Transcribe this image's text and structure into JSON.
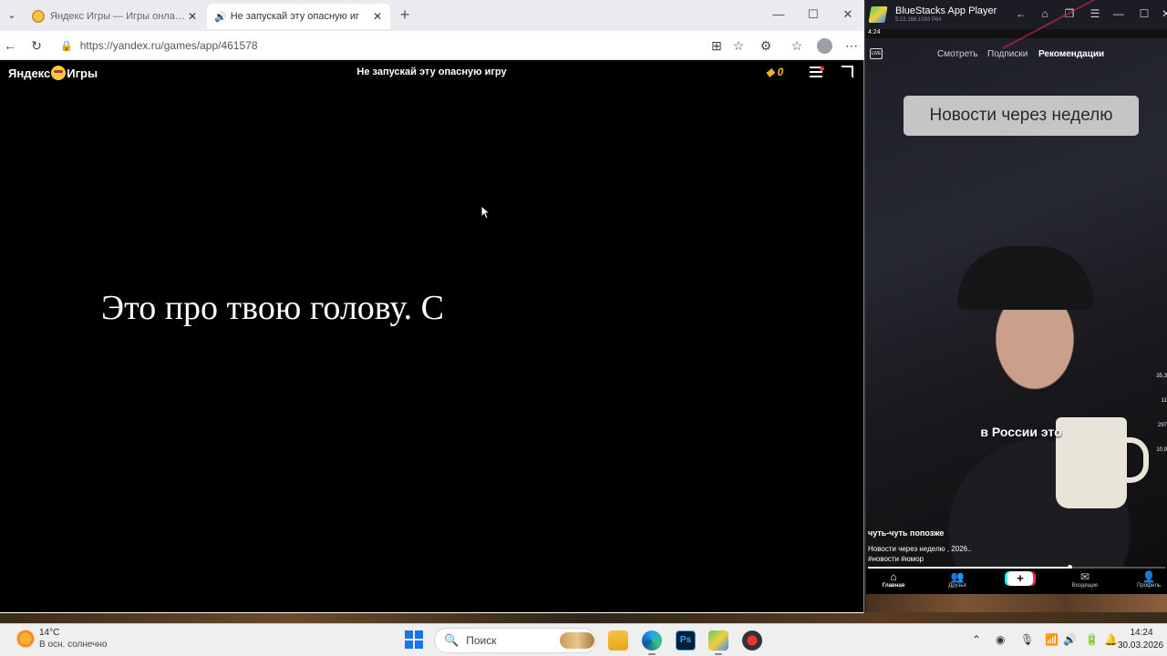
{
  "browser": {
    "tabs": [
      {
        "title": "Яндекс Игры — Игры онлайн бе",
        "active": false
      },
      {
        "title": "Не запускай эту опасную иг",
        "active": true
      }
    ],
    "url": "https://yandex.ru/games/app/461578"
  },
  "game": {
    "logo": "Яндекс",
    "logo_suffix": "Игры",
    "title": "Не запускай эту опасную игру",
    "coins": "0",
    "dialogue_text": "Это про твою голову. С"
  },
  "bluestacks": {
    "app_name": "BlueStacks App Player",
    "version": "5.22.166.1003 P64",
    "status_time": "4:24",
    "feed_tabs": [
      "Смотреть",
      "Подписки",
      "Рекомендации"
    ],
    "headline": "Новости через неделю",
    "subtitle": "в России это",
    "post_title": "чуть-чуть попозже",
    "post_desc_line1": "Новости через неделю , 2026..",
    "post_desc_line2": "#новости #юмор",
    "video_progress": 0.68,
    "side_counts": [
      "35,3",
      "11",
      "297",
      "10,9"
    ],
    "nav": [
      {
        "label": "Главная",
        "icon": "home-icon",
        "glyph": "⌂",
        "active": true
      },
      {
        "label": "Друзья",
        "icon": "friends-icon",
        "glyph": "👥",
        "active": false
      },
      {
        "label": "Входящие",
        "icon": "inbox-icon",
        "glyph": "✉",
        "active": false
      },
      {
        "label": "Профиль",
        "icon": "profile-icon",
        "glyph": "👤",
        "active": false
      }
    ]
  },
  "taskbar": {
    "temperature": "14°C",
    "weather": "В осн. солнечно",
    "search_placeholder": "Поиск",
    "time": "14:24",
    "date": "30.03.2026"
  },
  "colors": {
    "accent": "#1a73e8",
    "coin": "#f0b429",
    "notification": "#ff3b30"
  }
}
